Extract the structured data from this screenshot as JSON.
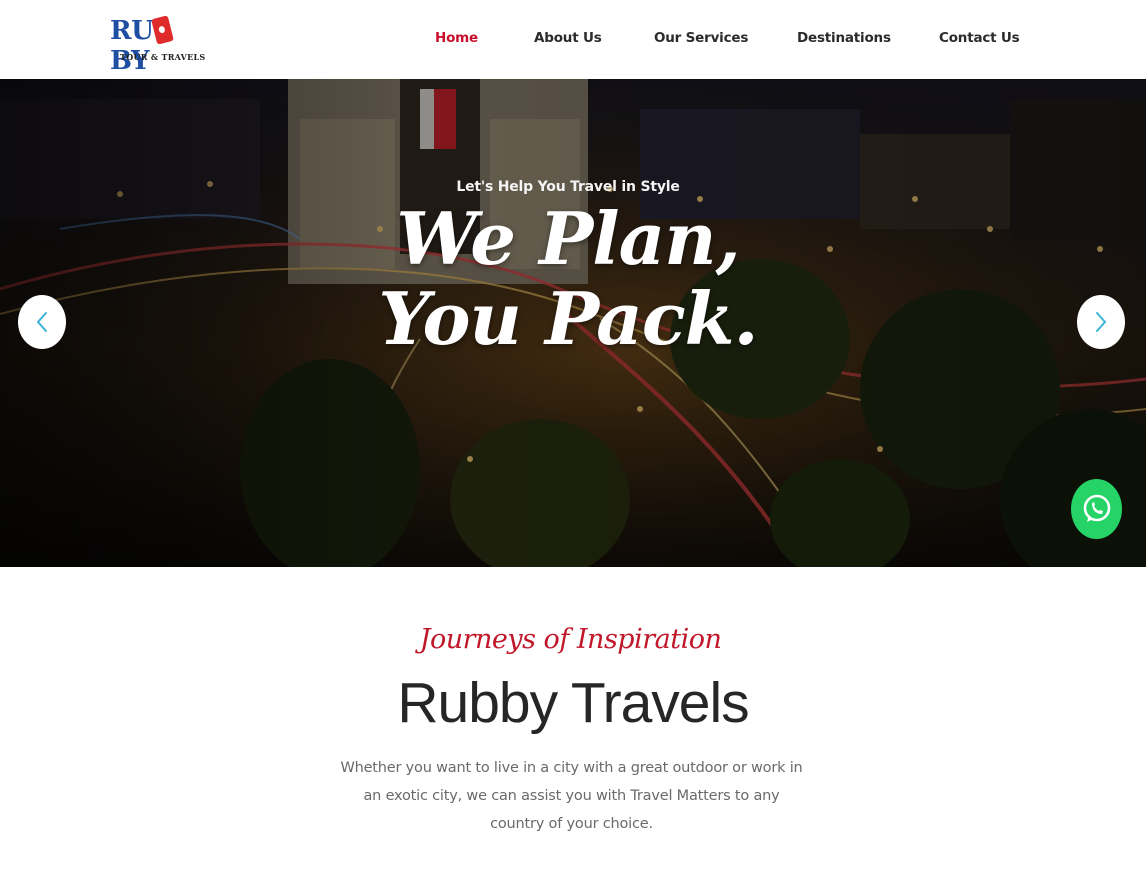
{
  "brand": {
    "logo_text_left": "RU",
    "logo_text_right": "BY",
    "tagline": "TOUR & TRAVELS",
    "primary_color": "#1f4fa3",
    "accent_color": "#e02b2b"
  },
  "nav": {
    "items": [
      {
        "label": "Home",
        "active": true
      },
      {
        "label": "About Us",
        "active": false
      },
      {
        "label": "Our Services",
        "active": false
      },
      {
        "label": "Destinations",
        "active": false
      },
      {
        "label": "Contact Us",
        "active": false
      }
    ],
    "active_color": "#c8102e"
  },
  "hero": {
    "kicker": "Let's Help You Travel in Style",
    "title_line1": "We Plan,",
    "title_line2": "You Pack.",
    "prev_icon": "chevron-left-icon",
    "next_icon": "chevron-right-icon",
    "arrow_color": "#3bb3d6"
  },
  "whatsapp": {
    "icon": "whatsapp-icon",
    "color": "#25d366"
  },
  "intro": {
    "script_heading": "Journeys of Inspiration",
    "title": "Rubby Travels",
    "text": "Whether you want to live in a city with a great outdoor or work in an exotic city, we can assist you with Travel Matters to any country of your choice."
  }
}
